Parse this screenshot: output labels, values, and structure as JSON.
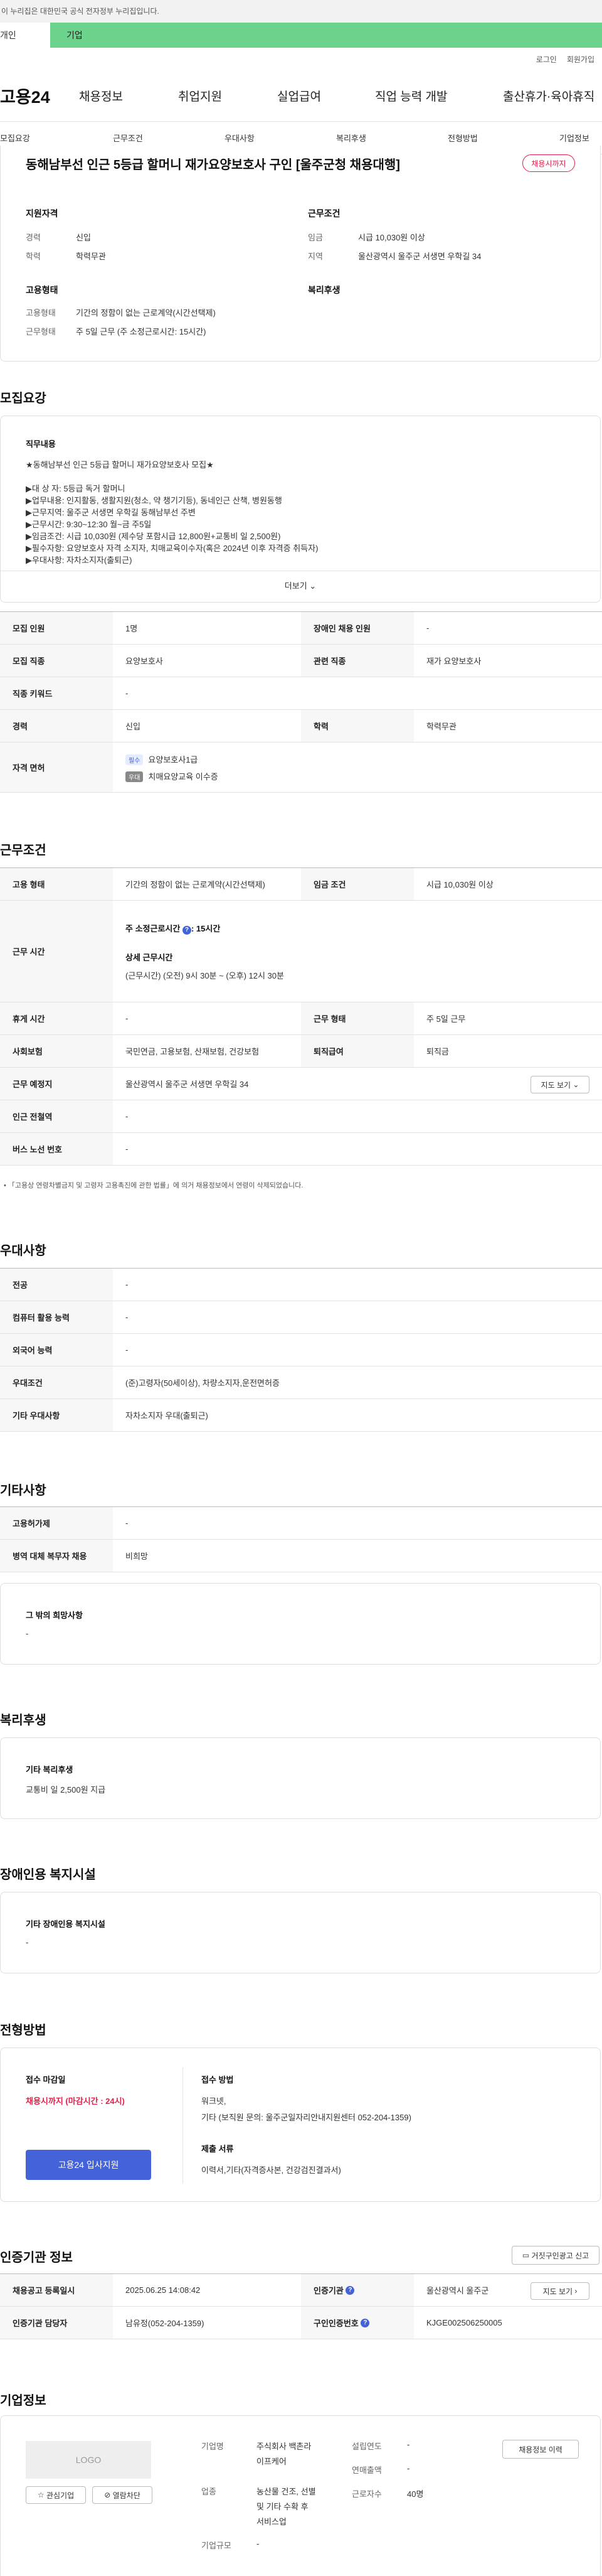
{
  "notice": "이 누리집은 대한민국 공식 전자정부 누리집입니다.",
  "usertabs": {
    "personal": "개인",
    "biz": "기업"
  },
  "toplinks": [
    "로그인",
    "회원가입"
  ],
  "gnb": {
    "logo": "고용24",
    "items": [
      "채용정보",
      "취업지원",
      "실업급여",
      "직업 능력 개발",
      "출산휴가·육아휴직"
    ]
  },
  "anchors": [
    "모집요강",
    "근무조건",
    "우대사항",
    "복리후생",
    "전형방법",
    "기업정보"
  ],
  "summary": {
    "title": "동해남부선 인근 5등급 할머니 재가요양보호사 구인 [울주군청 채용대행]",
    "badge": "채용시까지",
    "qual_head": "지원자격",
    "cond_head": "근무조건",
    "career_l": "경력",
    "career_v": "신입",
    "edu_l": "학력",
    "edu_v": "학력무관",
    "wage_l": "임금",
    "wage_v": "시급 10,030원 이상",
    "area_l": "지역",
    "area_v": "울산광역시 울주군 서생면 우학길 34",
    "emp_head": "고용형태",
    "welfare_head": "복리후생",
    "emptype_l": "고용형태",
    "emptype_v": "기간의 정함이 없는 근로계약(시간선택제)",
    "worktype_l": "근무형태",
    "worktype_v": "주 5일 근무 (주 소정근로시간: 15시간)"
  },
  "recruit": {
    "title": "모집요강",
    "duty_head": "직무내용",
    "duty_lines": [
      "★동해남부선 인근 5등급 할머니 재가요양보호사 모집★",
      "",
      "▶대 상 자: 5등급 독거 할머니",
      "▶업무내용: 인지활동, 생활지원(청소, 약 챙기기등), 동네인근 산책, 병원동행",
      "▶근무지역: 울주군 서생면 우학길 동해남부선 주변",
      "▶근무시간: 9:30~12:30  월~금 주5일",
      "▶임금조건: 시급 10,030원 (제수당 포함시급 12,800원+교통비 일 2,500원)",
      "▶필수자항: 요양보호사 자격 소지자, 치매교육이수자(혹은 2024년 이후 자격증 취득자)",
      "▶우대사항: 자차소지자(출퇴근)"
    ],
    "more": "더보기",
    "rows": [
      {
        "th1": "모집 인원",
        "td1": "1명",
        "th2": "장애인 채용 인원",
        "td2": "-"
      },
      {
        "th1": "모집 직종",
        "td1": "요양보호사",
        "th2": "관련 직종",
        "td2": "재가 요양보호사"
      },
      {
        "th1": "직종 키워드",
        "td1": "-"
      },
      {
        "th1": "경력",
        "td1": "신입",
        "th2": "학력",
        "td2": "학력무관"
      }
    ],
    "license_th": "자격 면허",
    "licenses": [
      {
        "tag": "필수",
        "name": "요양보호사1급"
      },
      {
        "tag": "우대",
        "name": "치매요양교육 이수증"
      }
    ]
  },
  "work": {
    "title": "근무조건",
    "emp_th": "고용 형태",
    "emp_td": "기간의 정함이 없는 근로계약(시간선택제)",
    "wage_th": "임금 조건",
    "wage_td": "시급 10,030원 이상",
    "time_th": "근무 시간",
    "time_l1": "주 소정근로시간",
    "time_l1b": ": 15시간",
    "time_l2": "상세 근무시간",
    "time_l3": "(근무시간) (오전) 9시 30분 ~ (오후) 12시 30분",
    "rest_th": "휴게 시간",
    "rest_td": "-",
    "form_th": "근무 형태",
    "form_td": "주 5일 근무",
    "ins_th": "사회보험",
    "ins_td": "국민연금, 고용보험, 산재보험, 건강보험",
    "ret_th": "퇴직급여",
    "ret_td": "퇴직금",
    "place_th": "근무 예정지",
    "place_td": "울산광역시 울주군 서생면 우학길 34",
    "map_btn": "지도 보기",
    "sub_th": "인근 전철역",
    "sub_td": "-",
    "bus_th": "버스 노선 번호",
    "bus_td": "-",
    "note": "「고용상 연령차별금지 및 고령자 고용촉진에 관한 법률」에 의거 채용정보에서 연령이 삭제되었습니다."
  },
  "pref": {
    "title": "우대사항",
    "rows": [
      {
        "th": "전공",
        "td": "-"
      },
      {
        "th": "컴퓨터 활용 능력",
        "td": "-"
      },
      {
        "th": "외국어 능력",
        "td": "-"
      },
      {
        "th": "우대조건",
        "td": "(준)고령자(50세이상), 차량소지자,운전면허증"
      },
      {
        "th": "기타 우대사항",
        "td": "자차소지자 우대(출퇴근)"
      }
    ]
  },
  "etc": {
    "title": "기타사항",
    "rows": [
      {
        "th": "고용허가제",
        "td": "-"
      },
      {
        "th": "병역 대체 복무자 채용",
        "td": "비희망"
      }
    ],
    "box_head": "그 밖의 희망사항",
    "box_val": "-"
  },
  "welfare": {
    "title": "복리후생",
    "box_head": "기타 복리후생",
    "box_val": "교통비 일 2,500원 지급"
  },
  "disabled": {
    "title": "장애인용 복지시설",
    "box_head": "기타 장애인용 복지시설",
    "box_val": "-"
  },
  "process": {
    "title": "전형방법",
    "deadline_l": "접수 마감일",
    "deadline_v": "채용시까지 (마감시간 : 24시)",
    "apply_btn": "고용24 입사지원",
    "method_l": "접수 방법",
    "method_v1": "워크넷,",
    "method_v2": "기타 (보직원 문의: 울주군일자리안내지원센터 052-204-1359)",
    "docs_l": "제출 서류",
    "docs_v": "이력서,기타(자격증사본, 건강검진결과서)"
  },
  "auth": {
    "title": "인증기관 정보",
    "report_btn": "거짓구인광고 신고",
    "reg_th": "채용공고 등록일시",
    "reg_td": "2025.06.25 14:08:42",
    "org_th": "인증기관",
    "org_td": "울산광역시 울주군",
    "map_btn": "지도 보기",
    "mgr_th": "인증기관 담당자",
    "mgr_td": "남유정(052-204-1359)",
    "no_th": "구인인증번호",
    "no_td": "KJGE002506250005"
  },
  "company": {
    "title": "기업정보",
    "logo": "LOGO",
    "fav": "관심기업",
    "block": "열람차단",
    "history": "채용정보 이력",
    "name_l": "기업명",
    "name_v1": "주식회사 백촌라",
    "name_v2": "이프케어",
    "ind_l": "업종",
    "ind_v1": "농산물 건조, 선별",
    "ind_v2": "및 기타 수확 후",
    "ind_v3": "서비스업",
    "size_l": "기업규모",
    "size_v": "-",
    "year_l": "설립연도",
    "year_v": "-",
    "sales_l": "연매출액",
    "sales_v": "-",
    "emp_l": "근로자수",
    "emp_v": "40명"
  },
  "colors": {
    "accent": "#4563d8",
    "badge": "#e0224b",
    "biz_tab": "#6bd38c"
  }
}
